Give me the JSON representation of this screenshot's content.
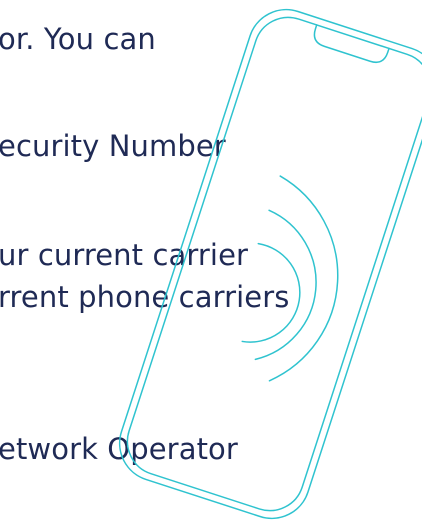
{
  "text_lines": [
    "or. You can",
    "ecurity Number",
    "ur current carrier",
    "rrent phone carriers",
    "etwork Operator"
  ],
  "colors": {
    "text": "#1f2a55",
    "phone_outline": "#2fc3cf",
    "background": "#ffffff"
  },
  "illustration": {
    "icon": "phone-outline-with-wifi-waves"
  }
}
